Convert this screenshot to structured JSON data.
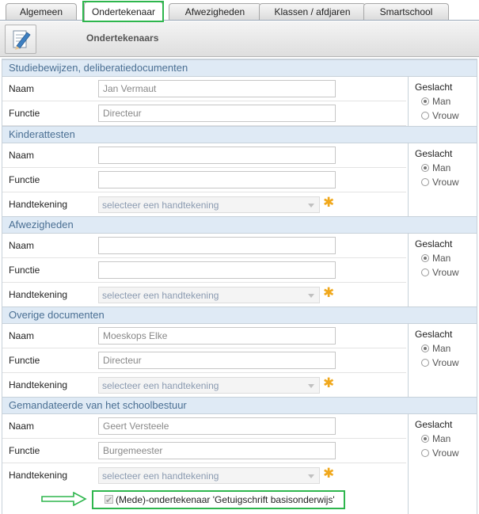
{
  "tabs": [
    "Algemeen",
    "Ondertekenaar",
    "Afwezigheden",
    "Klassen / afdjaren",
    "Smartschool"
  ],
  "header": {
    "title": "Ondertekenaars",
    "icon": "edit-document-icon"
  },
  "labels": {
    "naam": "Naam",
    "functie": "Functie",
    "handtekening": "Handtekening",
    "geslacht": "Geslacht",
    "man": "Man",
    "vrouw": "Vrouw"
  },
  "select_placeholder": "selecteer een handtekening",
  "sections": [
    {
      "title": "Studiebewijzen, deliberatiedocumenten",
      "naam": "Jan Vermaut",
      "functie": "Directeur",
      "gender": "Man"
    },
    {
      "title": "Kinderattesten",
      "naam": "",
      "functie": "",
      "gender": "Man"
    },
    {
      "title": "Afwezigheden",
      "naam": "",
      "functie": "",
      "gender": "Man"
    },
    {
      "title": "Overige documenten",
      "naam": "Moeskops Elke",
      "functie": "Directeur",
      "gender": "Man"
    },
    {
      "title": "Gemandateerde van het schoolbestuur",
      "naam": "Geert Versteele",
      "functie": "Burgemeester",
      "gender": "Man"
    }
  ],
  "checkbox_label": "(Mede)-ondertekenaar 'Getuigschrift basisonderwijs'",
  "colors": {
    "section_bg": "#dfeaf5",
    "section_text": "#4a6f93",
    "highlight": "#2eb64d",
    "star": "#f0a81c"
  }
}
